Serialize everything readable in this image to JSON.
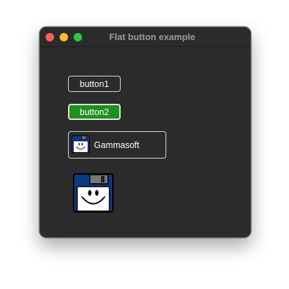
{
  "window": {
    "title": "Flat button example"
  },
  "buttons": {
    "button1_label": "button1",
    "button2_label": "button2",
    "button3_label": "Gammasoft"
  },
  "icons": {
    "floppy": "floppy-disk-smiley-icon"
  },
  "colors": {
    "window_bg": "#2b2b2b",
    "button2_bg": "#1f8f1f",
    "floppy_blue": "#0b3a82"
  }
}
